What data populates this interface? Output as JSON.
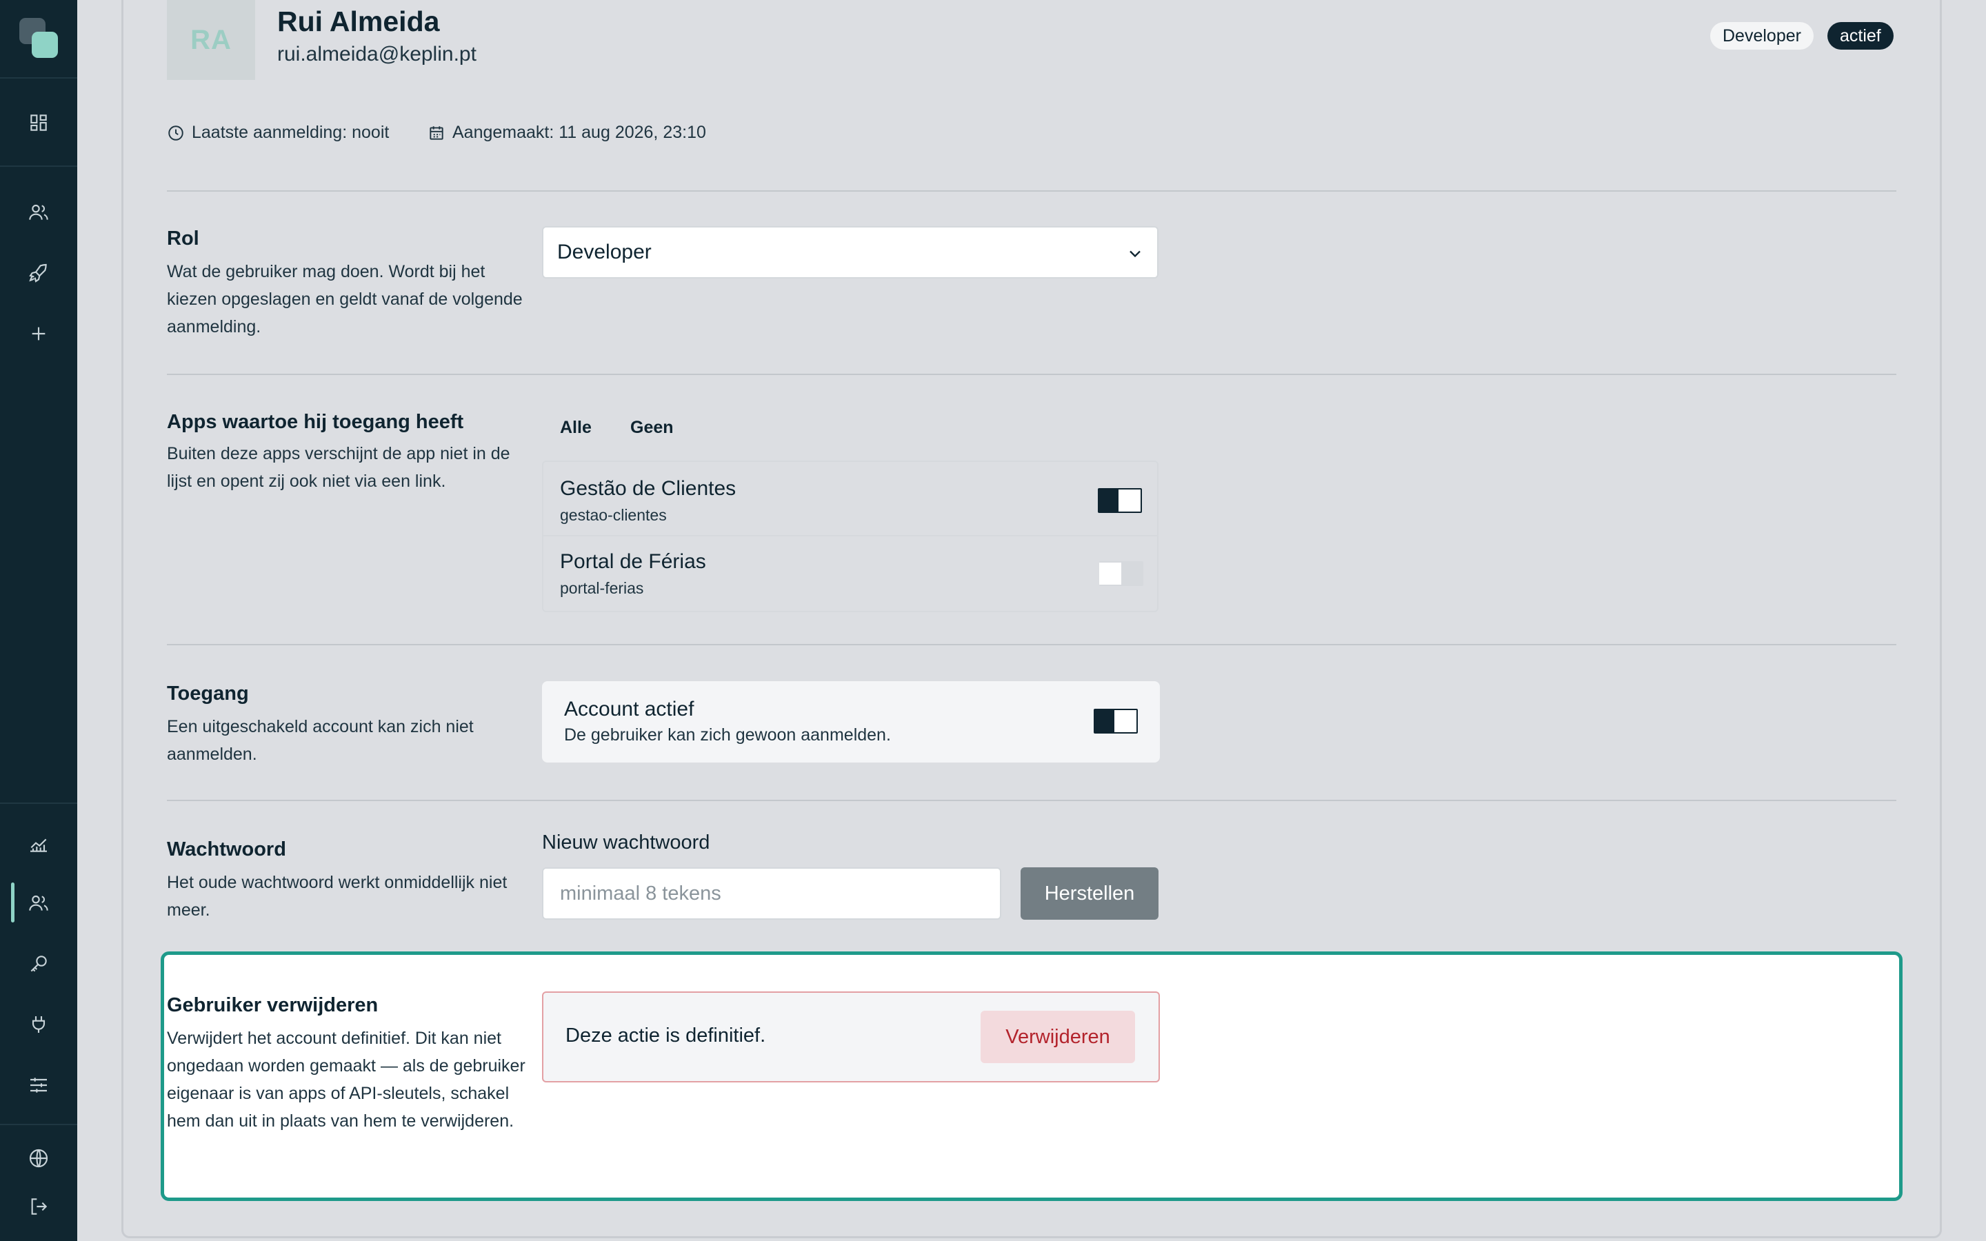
{
  "user": {
    "initials": "RA",
    "name": "Rui Almeida",
    "email": "rui.almeida@keplin.pt",
    "badges": [
      "Developer",
      "actief"
    ],
    "last_login": "Laatste aanmelding: nooit",
    "created": "Aangemaakt: 11 aug 2026, 23:10"
  },
  "sidebar": {
    "icons": [
      "dashboard-icon",
      "users-icon",
      "rocket-icon",
      "plus-icon",
      "chart-icon",
      "users-icon",
      "key-icon",
      "plug-icon",
      "sliders-icon",
      "globe-icon",
      "logout-icon"
    ],
    "active_item": "users"
  },
  "role": {
    "title": "Rol",
    "description": "Wat de gebruiker mag doen. Wordt bij het kiezen opgeslagen en geldt vanaf de volgende aanmelding.",
    "selected": "Developer"
  },
  "apps": {
    "title": "Apps waartoe hij toegang heeft",
    "description": "Buiten deze apps verschijnt de app niet in de lijst en opent zij ook niet via een link.",
    "all_label": "Alle",
    "none_label": "Geen",
    "items": [
      {
        "name": "Gestão de Clientes",
        "slug": "gestao-clientes",
        "enabled": true
      },
      {
        "name": "Portal de Férias",
        "slug": "portal-ferias",
        "enabled": false
      }
    ]
  },
  "access": {
    "title": "Toegang",
    "description": "Een uitgeschakeld account kan zich niet aanmelden.",
    "box_title": "Account actief",
    "box_desc": "De gebruiker kan zich gewoon aanmelden.",
    "enabled": true
  },
  "password": {
    "title": "Wachtwoord",
    "description": "Het oude wachtwoord werkt onmiddellijk niet meer.",
    "label": "Nieuw wachtwoord",
    "placeholder": "minimaal 8 tekens",
    "value": "",
    "button": "Herstellen"
  },
  "delete": {
    "title": "Gebruiker verwijderen",
    "description": "Verwijdert het account definitief. Dit kan niet ongedaan worden gemaakt — als de gebruiker eigenaar is van apps of API-sleutels, schakel hem dan uit in plaats van hem te verwijderen.",
    "box_text": "Deze actie is definitief.",
    "button": "Verwijderen"
  },
  "colors": {
    "sidebar": "#102630",
    "accent": "#1e9a8a",
    "danger": "#b3232c"
  }
}
